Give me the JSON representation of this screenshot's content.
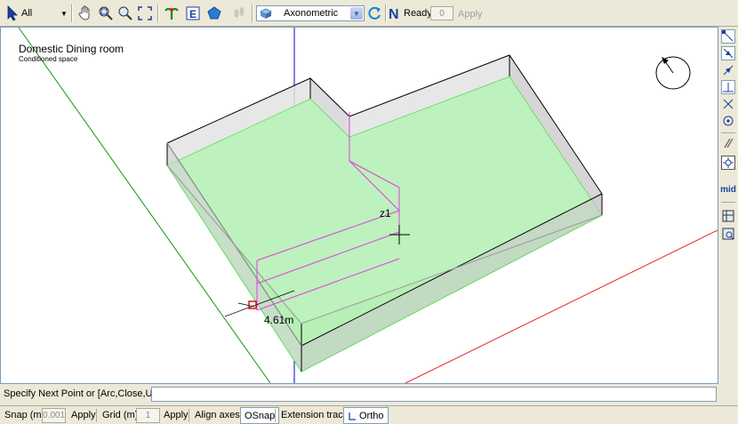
{
  "toolbar": {
    "select_filter": "All",
    "view_mode": "Axonometric",
    "status_label": "Ready",
    "count_value": "0",
    "apply_label": "Apply"
  },
  "viewport": {
    "zone_title": "Domestic Dining room",
    "zone_subtitle": "Conditioned space",
    "dimension_label": "4.61m",
    "height_marker": "z1"
  },
  "right_toolbar": {
    "mid_label": "mid"
  },
  "command": {
    "prompt": "Specify Next Point or [Arc,Close,Undo]:",
    "input_value": ""
  },
  "status": {
    "snap_label": "Snap (m)",
    "snap_value": "0.001",
    "snap_apply": "Apply",
    "grid_label": "Grid (m)",
    "grid_value": "1",
    "grid_apply": "Apply",
    "align_axes": "Align axes",
    "osnap": "OSnap",
    "extension_track": "Extension track",
    "ortho": "Ortho"
  },
  "colors": {
    "floor_fill": "#b3f2b3",
    "floor_edge": "#33dd33",
    "wall_fill": "#d9d9d9",
    "selection": "#e040e0",
    "axis_blue": "#0000cc",
    "axis_red": "#ee2222",
    "axis_green": "#119911"
  }
}
